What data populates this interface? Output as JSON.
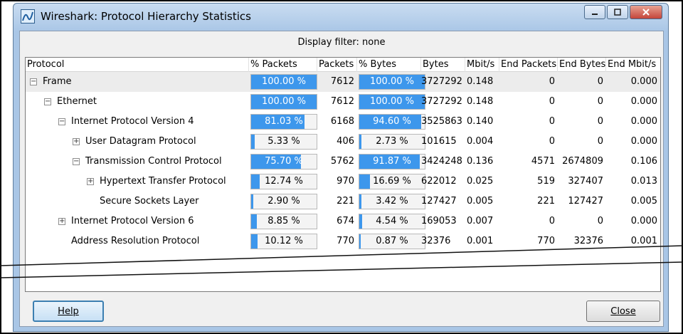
{
  "window": {
    "title": "Wireshark: Protocol Hierarchy Statistics",
    "icon": "wireshark-icon"
  },
  "filter_label": "Display filter: none",
  "columns": [
    "Protocol",
    "% Packets",
    "Packets",
    "% Bytes",
    "Bytes",
    "Mbit/s",
    "End Packets",
    "End Bytes",
    "End Mbit/s"
  ],
  "rows": [
    {
      "level": 0,
      "toggle": "minus",
      "protocol": "Frame",
      "pct_packets": "100.00 %",
      "pct_packets_fill": 1.0,
      "packets": "7612",
      "pct_bytes": "100.00 %",
      "pct_bytes_fill": 1.0,
      "bytes": "3727292",
      "mbits": "0.148",
      "end_packets": "0",
      "end_bytes": "0",
      "end_mbits": "0.000"
    },
    {
      "level": 1,
      "toggle": "minus",
      "protocol": "Ethernet",
      "pct_packets": "100.00 %",
      "pct_packets_fill": 1.0,
      "packets": "7612",
      "pct_bytes": "100.00 %",
      "pct_bytes_fill": 1.0,
      "bytes": "3727292",
      "mbits": "0.148",
      "end_packets": "0",
      "end_bytes": "0",
      "end_mbits": "0.000"
    },
    {
      "level": 2,
      "toggle": "minus",
      "protocol": "Internet Protocol Version 4",
      "pct_packets": "81.03 %",
      "pct_packets_fill": 0.8103,
      "packets": "6168",
      "pct_bytes": "94.60 %",
      "pct_bytes_fill": 0.946,
      "bytes": "3525863",
      "mbits": "0.140",
      "end_packets": "0",
      "end_bytes": "0",
      "end_mbits": "0.000"
    },
    {
      "level": 3,
      "toggle": "plus",
      "protocol": "User Datagram Protocol",
      "pct_packets": "5.33 %",
      "pct_packets_fill": 0.0533,
      "packets": "406",
      "pct_bytes": "2.73 %",
      "pct_bytes_fill": 0.0273,
      "bytes": "101615",
      "mbits": "0.004",
      "end_packets": "0",
      "end_bytes": "0",
      "end_mbits": "0.000"
    },
    {
      "level": 3,
      "toggle": "minus",
      "protocol": "Transmission Control Protocol",
      "pct_packets": "75.70 %",
      "pct_packets_fill": 0.757,
      "packets": "5762",
      "pct_bytes": "91.87 %",
      "pct_bytes_fill": 0.9187,
      "bytes": "3424248",
      "mbits": "0.136",
      "end_packets": "4571",
      "end_bytes": "2674809",
      "end_mbits": "0.106"
    },
    {
      "level": 4,
      "toggle": "plus",
      "protocol": "Hypertext Transfer Protocol",
      "pct_packets": "12.74 %",
      "pct_packets_fill": 0.1274,
      "packets": "970",
      "pct_bytes": "16.69 %",
      "pct_bytes_fill": 0.1669,
      "bytes": "622012",
      "mbits": "0.025",
      "end_packets": "519",
      "end_bytes": "327407",
      "end_mbits": "0.013"
    },
    {
      "level": 4,
      "toggle": "none",
      "protocol": "Secure Sockets Layer",
      "pct_packets": "2.90 %",
      "pct_packets_fill": 0.029,
      "packets": "221",
      "pct_bytes": "3.42 %",
      "pct_bytes_fill": 0.0342,
      "bytes": "127427",
      "mbits": "0.005",
      "end_packets": "221",
      "end_bytes": "127427",
      "end_mbits": "0.005"
    },
    {
      "level": 2,
      "toggle": "plus",
      "protocol": "Internet Protocol Version 6",
      "pct_packets": "8.85 %",
      "pct_packets_fill": 0.0885,
      "packets": "674",
      "pct_bytes": "4.54 %",
      "pct_bytes_fill": 0.0454,
      "bytes": "169053",
      "mbits": "0.007",
      "end_packets": "0",
      "end_bytes": "0",
      "end_mbits": "0.000"
    },
    {
      "level": 2,
      "toggle": "none",
      "protocol": "Address Resolution Protocol",
      "pct_packets": "10.12 %",
      "pct_packets_fill": 0.1012,
      "packets": "770",
      "pct_bytes": "0.87 %",
      "pct_bytes_fill": 0.0087,
      "bytes": "32376",
      "mbits": "0.001",
      "end_packets": "770",
      "end_bytes": "32376",
      "end_mbits": "0.001"
    }
  ],
  "buttons": {
    "help_label": "Help",
    "close_label": "Close"
  },
  "colors": {
    "bar_fill": "#3d97ec",
    "selected_row": "#ececec"
  }
}
